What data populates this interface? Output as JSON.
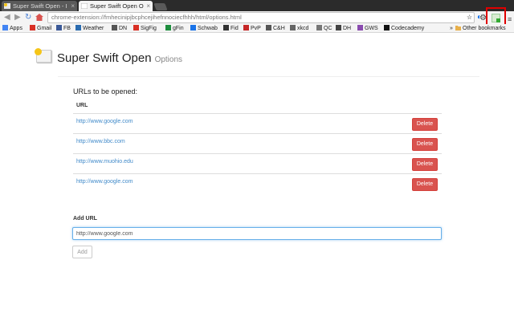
{
  "browser": {
    "tabs": [
      {
        "label": "Super Swift Open - I",
        "active": false
      },
      {
        "label": "Super Swift Open O",
        "active": true
      }
    ],
    "tab_close": "×",
    "address": "chrome-extension://fmhecinipjbcphcejihefnnociecfhhh/html/options.html",
    "bookmarks": [
      {
        "label": "Apps",
        "color": "#4285f4"
      },
      {
        "label": "Gmail",
        "color": "#d93025"
      },
      {
        "label": "FB",
        "color": "#3b5998"
      },
      {
        "label": "Weather",
        "color": "#2b6cb0"
      },
      {
        "label": "DN",
        "color": "#555555"
      },
      {
        "label": "SigFig",
        "color": "#d93025"
      },
      {
        "label": "gFin",
        "color": "#1e8e3e"
      },
      {
        "label": "Schwab",
        "color": "#1a73e8"
      },
      {
        "label": "Fid",
        "color": "#333333"
      },
      {
        "label": "PvP",
        "color": "#c62828"
      },
      {
        "label": "C&H",
        "color": "#555555"
      },
      {
        "label": "xkcd",
        "color": "#666666"
      },
      {
        "label": "QC",
        "color": "#777777"
      },
      {
        "label": "DH",
        "color": "#444444"
      },
      {
        "label": "GWS",
        "color": "#8a4baf"
      },
      {
        "label": "Codecademy",
        "color": "#111111"
      }
    ],
    "other_bookmarks": "Other bookmarks",
    "overflow": "»"
  },
  "page": {
    "title": "Super Swift Open",
    "subtitle": "Options",
    "urls_heading": "URLs to be opened:",
    "column_header": "URL",
    "urls": [
      {
        "url": "http://www.google.com",
        "button": "Delete"
      },
      {
        "url": "http://www.bbc.com",
        "button": "Delete"
      },
      {
        "url": "http://www.muohio.edu",
        "button": "Delete"
      },
      {
        "url": "http://www.google.com",
        "button": "Delete"
      }
    ],
    "add_label": "Add URL",
    "add_input_value": "http://www.google.com",
    "add_button": "Add"
  },
  "colors": {
    "delete": "#d9534f",
    "link": "#428bca",
    "highlight": "#e00000"
  }
}
